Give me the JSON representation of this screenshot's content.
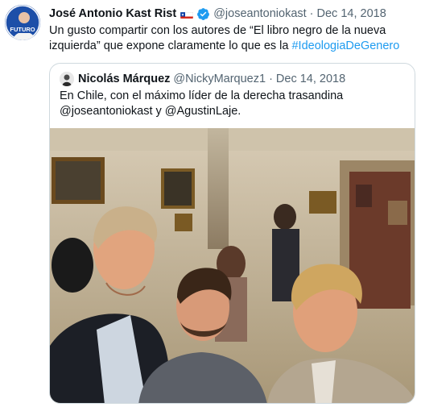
{
  "tweet": {
    "author_name": "José Antonio Kast Rist",
    "handle": "@joseantoniokast",
    "separator": "·",
    "date": "Dec 14, 2018",
    "more_icon": "more-horizontal-icon",
    "text_before": "Un gusto compartir con los autores de “El libro negro de la nueva izquierda” que expone claramente lo que es la ",
    "hashtag": "#IdeologiaDeGenero",
    "avatar_text": "FUTURO"
  },
  "quote": {
    "author_name": "Nicolás Márquez",
    "handle": "@NickyMarquez1",
    "separator": "·",
    "date": "Dec 14, 2018",
    "text": "En Chile, con el máximo líder de la derecha trasandina @joseantoniokast y @AgustinLaje."
  },
  "colors": {
    "accent": "#1d9bf0",
    "secondary_text": "#536471",
    "border": "#cfd9de"
  }
}
